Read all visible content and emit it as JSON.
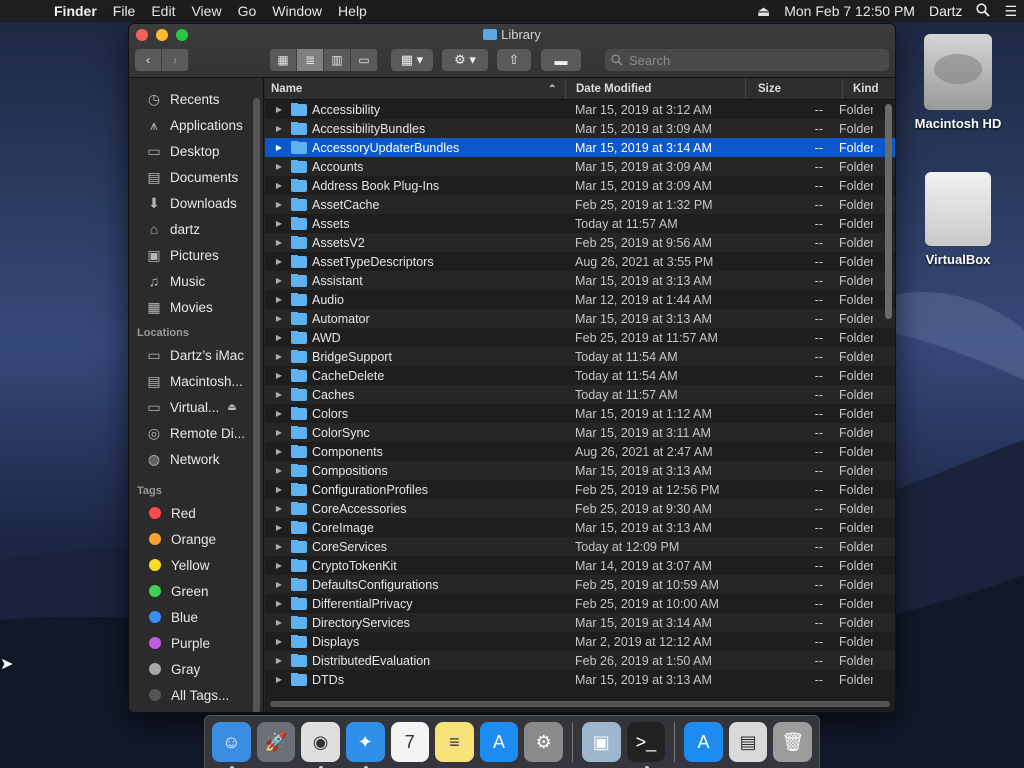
{
  "menubar": {
    "items": [
      "Finder",
      "File",
      "Edit",
      "View",
      "Go",
      "Window",
      "Help"
    ],
    "clock": "Mon Feb 7  12:50 PM",
    "user": "Dartz"
  },
  "window": {
    "title": "Library",
    "search_placeholder": "Search",
    "columns": {
      "name": "Name",
      "date": "Date Modified",
      "size": "Size",
      "kind": "Kind"
    }
  },
  "sidebar": {
    "favorites": [
      {
        "label": "Recents",
        "icon": "recents-icon"
      },
      {
        "label": "Applications",
        "icon": "applications-icon"
      },
      {
        "label": "Desktop",
        "icon": "desktop-icon"
      },
      {
        "label": "Documents",
        "icon": "documents-icon"
      },
      {
        "label": "Downloads",
        "icon": "downloads-icon"
      },
      {
        "label": "dartz",
        "icon": "home-icon"
      },
      {
        "label": "Pictures",
        "icon": "pictures-icon"
      },
      {
        "label": "Music",
        "icon": "music-icon"
      },
      {
        "label": "Movies",
        "icon": "movies-icon"
      }
    ],
    "locations_title": "Locations",
    "locations": [
      {
        "label": "Dartz’s iMac",
        "icon": "imac-icon"
      },
      {
        "label": "Macintosh...",
        "icon": "disk-icon"
      },
      {
        "label": "Virtual...",
        "icon": "external-disk-icon"
      },
      {
        "label": "Remote Di...",
        "icon": "remote-disc-icon"
      },
      {
        "label": "Network",
        "icon": "network-icon"
      }
    ],
    "tags_title": "Tags",
    "tags": [
      {
        "label": "Red",
        "color": "#fc4b4b"
      },
      {
        "label": "Orange",
        "color": "#fda22b"
      },
      {
        "label": "Yellow",
        "color": "#f9db2c"
      },
      {
        "label": "Green",
        "color": "#3fcf57"
      },
      {
        "label": "Blue",
        "color": "#3a8cf7"
      },
      {
        "label": "Purple",
        "color": "#c55ae0"
      },
      {
        "label": "Gray",
        "color": "#a8a8a8"
      },
      {
        "label": "All Tags...",
        "color": "#555555"
      }
    ]
  },
  "files": [
    {
      "name": "Accessibility",
      "date": "Mar 15, 2019 at 3:12 AM",
      "size": "--",
      "kind": "Folder"
    },
    {
      "name": "AccessibilityBundles",
      "date": "Mar 15, 2019 at 3:09 AM",
      "size": "--",
      "kind": "Folder"
    },
    {
      "name": "AccessoryUpdaterBundles",
      "date": "Mar 15, 2019 at 3:14 AM",
      "size": "--",
      "kind": "Folder",
      "selected": true
    },
    {
      "name": "Accounts",
      "date": "Mar 15, 2019 at 3:09 AM",
      "size": "--",
      "kind": "Folder"
    },
    {
      "name": "Address Book Plug-Ins",
      "date": "Mar 15, 2019 at 3:09 AM",
      "size": "--",
      "kind": "Folder"
    },
    {
      "name": "AssetCache",
      "date": "Feb 25, 2019 at 1:32 PM",
      "size": "--",
      "kind": "Folder"
    },
    {
      "name": "Assets",
      "date": "Today at 11:57 AM",
      "size": "--",
      "kind": "Folder"
    },
    {
      "name": "AssetsV2",
      "date": "Feb 25, 2019 at 9:56 AM",
      "size": "--",
      "kind": "Folder"
    },
    {
      "name": "AssetTypeDescriptors",
      "date": "Aug 26, 2021 at 3:55 PM",
      "size": "--",
      "kind": "Folder"
    },
    {
      "name": "Assistant",
      "date": "Mar 15, 2019 at 3:13 AM",
      "size": "--",
      "kind": "Folder"
    },
    {
      "name": "Audio",
      "date": "Mar 12, 2019 at 1:44 AM",
      "size": "--",
      "kind": "Folder"
    },
    {
      "name": "Automator",
      "date": "Mar 15, 2019 at 3:13 AM",
      "size": "--",
      "kind": "Folder"
    },
    {
      "name": "AWD",
      "date": "Feb 25, 2019 at 11:57 AM",
      "size": "--",
      "kind": "Folder"
    },
    {
      "name": "BridgeSupport",
      "date": "Today at 11:54 AM",
      "size": "--",
      "kind": "Folder"
    },
    {
      "name": "CacheDelete",
      "date": "Today at 11:54 AM",
      "size": "--",
      "kind": "Folder"
    },
    {
      "name": "Caches",
      "date": "Today at 11:57 AM",
      "size": "--",
      "kind": "Folder"
    },
    {
      "name": "Colors",
      "date": "Mar 15, 2019 at 1:12 AM",
      "size": "--",
      "kind": "Folder"
    },
    {
      "name": "ColorSync",
      "date": "Mar 15, 2019 at 3:11 AM",
      "size": "--",
      "kind": "Folder"
    },
    {
      "name": "Components",
      "date": "Aug 26, 2021 at 2:47 AM",
      "size": "--",
      "kind": "Folder"
    },
    {
      "name": "Compositions",
      "date": "Mar 15, 2019 at 3:13 AM",
      "size": "--",
      "kind": "Folder"
    },
    {
      "name": "ConfigurationProfiles",
      "date": "Feb 25, 2019 at 12:56 PM",
      "size": "--",
      "kind": "Folder"
    },
    {
      "name": "CoreAccessories",
      "date": "Feb 25, 2019 at 9:30 AM",
      "size": "--",
      "kind": "Folder"
    },
    {
      "name": "CoreImage",
      "date": "Mar 15, 2019 at 3:13 AM",
      "size": "--",
      "kind": "Folder"
    },
    {
      "name": "CoreServices",
      "date": "Today at 12:09 PM",
      "size": "--",
      "kind": "Folder"
    },
    {
      "name": "CryptoTokenKit",
      "date": "Mar 14, 2019 at 3:07 AM",
      "size": "--",
      "kind": "Folder"
    },
    {
      "name": "DefaultsConfigurations",
      "date": "Feb 25, 2019 at 10:59 AM",
      "size": "--",
      "kind": "Folder"
    },
    {
      "name": "DifferentialPrivacy",
      "date": "Feb 25, 2019 at 10:00 AM",
      "size": "--",
      "kind": "Folder"
    },
    {
      "name": "DirectoryServices",
      "date": "Mar 15, 2019 at 3:14 AM",
      "size": "--",
      "kind": "Folder"
    },
    {
      "name": "Displays",
      "date": "Mar 2, 2019 at 12:12 AM",
      "size": "--",
      "kind": "Folder"
    },
    {
      "name": "DistributedEvaluation",
      "date": "Feb 26, 2019 at 1:50 AM",
      "size": "--",
      "kind": "Folder"
    },
    {
      "name": "DTDs",
      "date": "Mar 15, 2019 at 3:13 AM",
      "size": "--",
      "kind": "Folder"
    }
  ],
  "desktop": {
    "icons": [
      {
        "label": "Macintosh HD",
        "icon": "hard-drive-icon"
      },
      {
        "label": "VirtualBox",
        "icon": "external-drive-icon"
      }
    ]
  },
  "dock": {
    "apps": [
      {
        "name": "finder-icon",
        "color": "#3a8de3",
        "glyph": "☺",
        "running": true
      },
      {
        "name": "launchpad-icon",
        "color": "#6b7078",
        "glyph": "🚀",
        "running": false
      },
      {
        "name": "chrome-icon",
        "color": "#dfdfdf",
        "glyph": "◉",
        "running": true
      },
      {
        "name": "safari-icon",
        "color": "#2f8ee8",
        "glyph": "✦",
        "running": true
      },
      {
        "name": "calendar-icon",
        "color": "#f4f4f4",
        "glyph": "7",
        "running": false
      },
      {
        "name": "notes-icon",
        "color": "#f7e27a",
        "glyph": "≡",
        "running": false
      },
      {
        "name": "app-store-icon",
        "color": "#1d8cf2",
        "glyph": "A",
        "running": false
      },
      {
        "name": "system-preferences-icon",
        "color": "#8a8a8a",
        "glyph": "⚙",
        "running": false
      },
      {
        "name": "preview-icon",
        "color": "#9fb6cf",
        "glyph": "▣",
        "running": false
      },
      {
        "name": "terminal-icon",
        "color": "#222222",
        "glyph": ">_",
        "running": true
      },
      {
        "name": "app-store-download-icon",
        "color": "#1d8cf2",
        "glyph": "A",
        "running": false
      },
      {
        "name": "downloads-stack-icon",
        "color": "#d9d9d9",
        "glyph": "▤",
        "running": false
      },
      {
        "name": "trash-icon",
        "color": "#9c9c9c",
        "glyph": "🗑",
        "running": false
      }
    ]
  }
}
